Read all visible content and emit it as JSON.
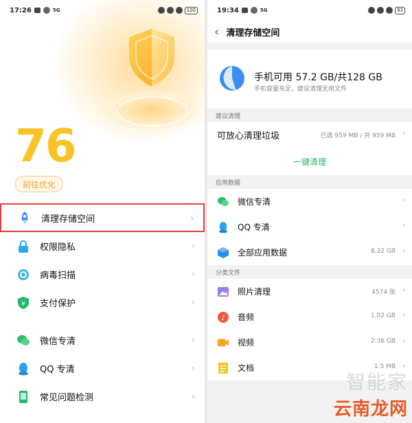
{
  "left": {
    "status": {
      "time": "17:26",
      "net": "5G",
      "battery": "100"
    },
    "score": "76",
    "optimize_label": "前往优化",
    "items": [
      {
        "label": "清理存储空间",
        "icon": "rocket-icon",
        "highlighted": true
      },
      {
        "label": "权限隐私",
        "icon": "lock-icon"
      },
      {
        "label": "病毒扫描",
        "icon": "virus-scan-icon"
      },
      {
        "label": "支付保护",
        "icon": "payment-shield-icon"
      },
      {
        "label": "微信专清",
        "icon": "wechat-icon"
      },
      {
        "label": "QQ 专清",
        "icon": "qq-penguin-icon"
      },
      {
        "label": "常见问题检测",
        "icon": "phone-check-icon"
      }
    ]
  },
  "right": {
    "status": {
      "time": "19:34",
      "net": "5G",
      "battery": "93"
    },
    "title": "清理存储空间",
    "storage": {
      "main": "手机可用 57.2 GB/共128 GB",
      "sub": "手机容量充足，建议清理无用文件",
      "used_fraction": 0.55
    },
    "suggest": {
      "header": "建议清理",
      "item_label": "可放心清理垃圾",
      "item_value": "已选 959 MB / 共 959 MB",
      "one_key": "一键清理"
    },
    "app_data": {
      "header": "应用数据",
      "items": [
        {
          "label": "微信专清",
          "value": "",
          "icon": "wechat-icon"
        },
        {
          "label": "QQ 专清",
          "value": "",
          "icon": "qq-penguin-icon"
        },
        {
          "label": "全部应用数据",
          "value": "8.32 GB",
          "icon": "cube-icon"
        }
      ]
    },
    "files": {
      "header": "分类文件",
      "items": [
        {
          "label": "照片清理",
          "value": "4574 张",
          "icon": "photo-icon"
        },
        {
          "label": "音频",
          "value": "1.02 GB",
          "icon": "music-icon"
        },
        {
          "label": "视频",
          "value": "2.36 GB",
          "icon": "video-icon"
        },
        {
          "label": "文档",
          "value": "1.5 MB",
          "icon": "document-icon"
        }
      ]
    }
  },
  "watermark": {
    "top": "智能家",
    "bottom": "云南龙网"
  },
  "colors": {
    "accent_green": "#2fb36f",
    "score_yellow": "#f8c324",
    "highlight_red": "#e83b3b"
  }
}
